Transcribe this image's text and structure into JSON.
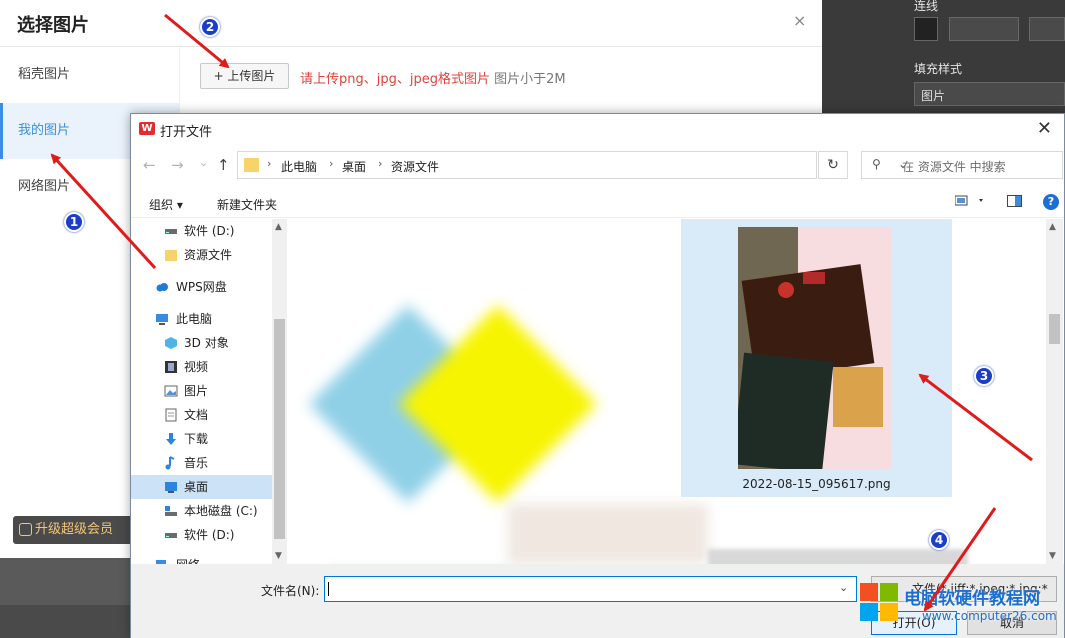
{
  "background_panel": {
    "line_label": "连线",
    "fill_style_label": "填充样式",
    "fill_value": "图片"
  },
  "select_dialog": {
    "title": "选择图片",
    "close_symbol": "×",
    "sidebar": [
      {
        "label": "稻壳图片",
        "active": false
      },
      {
        "label": "我的图片",
        "active": true
      },
      {
        "label": "网络图片",
        "active": false
      }
    ],
    "upload_button": "+ 上传图片",
    "upload_hint_red": "请上传png、jpg、jpeg格式图片",
    "upload_hint_gray": " 图片小于2M",
    "vip_button": "升级超级会员"
  },
  "file_dialog": {
    "title": "打开文件",
    "app_icon": "W",
    "close_symbol": "✕",
    "nav": {
      "back": "←",
      "forward": "→",
      "recent": "⌄",
      "up": "↑"
    },
    "breadcrumb": [
      "此电脑",
      "桌面",
      "资源文件"
    ],
    "breadcrumb_sep": "›",
    "refresh": "↻",
    "search_placeholder": "在 资源文件 中搜索",
    "toolbar": {
      "organize": "组织 ▾",
      "new_folder": "新建文件夹",
      "help": "?"
    },
    "tree": [
      {
        "label": "软件 (D:)",
        "icon": "drive-icon",
        "selected": false
      },
      {
        "label": "资源文件",
        "icon": "folder-icon",
        "selected": false
      },
      {
        "label": "WPS网盘",
        "icon": "cloud-icon",
        "selected": false
      },
      {
        "label": "此电脑",
        "icon": "computer-icon",
        "selected": false
      },
      {
        "label": "3D 对象",
        "icon": "cube-icon",
        "selected": false
      },
      {
        "label": "视频",
        "icon": "video-icon",
        "selected": false
      },
      {
        "label": "图片",
        "icon": "picture-icon",
        "selected": false
      },
      {
        "label": "文档",
        "icon": "document-icon",
        "selected": false
      },
      {
        "label": "下载",
        "icon": "download-icon",
        "selected": false
      },
      {
        "label": "音乐",
        "icon": "music-icon",
        "selected": false
      },
      {
        "label": "桌面",
        "icon": "desktop-icon",
        "selected": true
      },
      {
        "label": "本地磁盘 (C:)",
        "icon": "drive-icon",
        "selected": false
      },
      {
        "label": "软件 (D:)",
        "icon": "drive-icon",
        "selected": false
      },
      {
        "label": "网络",
        "icon": "network-icon",
        "selected": false
      }
    ],
    "selected_file": "2022-08-15_095617.png",
    "filename_label": "文件名(N):",
    "filename_value": "",
    "filetype": "文件(*.jiff;*.jpeg;*.jpg;*",
    "open_button": "打开(O)",
    "cancel_button": "取消"
  },
  "watermark": {
    "title": "电脑软硬件教程网",
    "url": "www.computer26.com"
  },
  "annotations": [
    "1",
    "2",
    "3",
    "4"
  ],
  "colors": {
    "accent": "#3b8fe0",
    "hint_red": "#e0433a",
    "arrow_red": "#e01b1b",
    "badge_blue": "#1a3ec9"
  }
}
